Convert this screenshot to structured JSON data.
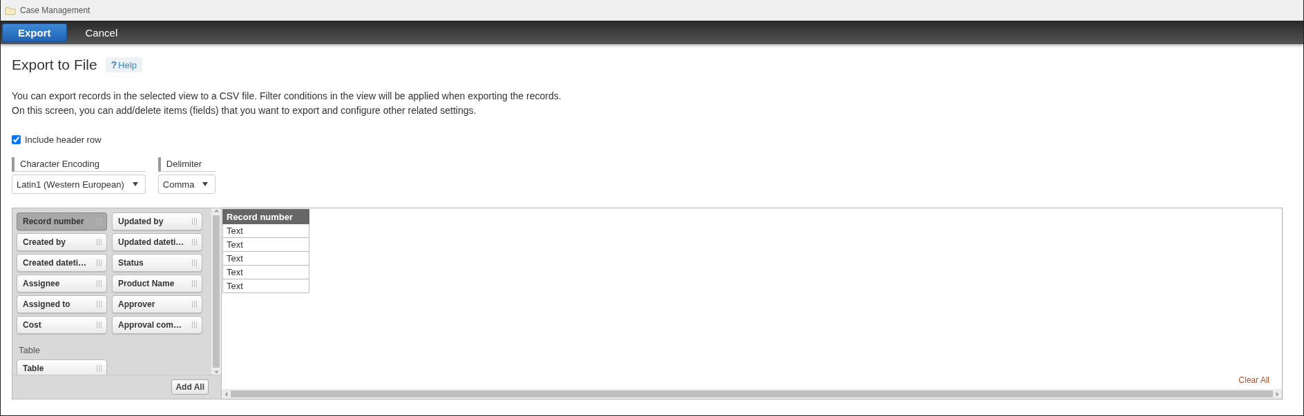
{
  "window": {
    "title": "Case Management"
  },
  "toolbar": {
    "buttons": [
      {
        "label": "Export",
        "primary": true
      },
      {
        "label": "Cancel",
        "primary": false
      }
    ]
  },
  "page": {
    "title": "Export to File",
    "help_icon": "?",
    "help": "Help"
  },
  "description": [
    "You can export records in the selected view to a CSV file. Filter conditions in the view will be applied when exporting the records.",
    "On this screen, you can add/delete items (fields) that you want to export and configure other related settings."
  ],
  "include_header_row": {
    "label": "Include header row",
    "checked": true
  },
  "settings": [
    {
      "label": "Character Encoding",
      "value": "Latin1 (Western European)"
    },
    {
      "label": "Delimiter",
      "value": "Comma"
    }
  ],
  "fields": [
    {
      "label": "Record number",
      "selected": true
    },
    {
      "label": "Updated by",
      "selected": false
    },
    {
      "label": "Created by",
      "selected": false
    },
    {
      "label": "Updated dateti…",
      "selected": false
    },
    {
      "label": "Created dateti…",
      "selected": false
    },
    {
      "label": "Status",
      "selected": false
    },
    {
      "label": "Assignee",
      "selected": false
    },
    {
      "label": "Product Name",
      "selected": false
    },
    {
      "label": "Assigned to",
      "selected": false
    },
    {
      "label": "Approver",
      "selected": false
    },
    {
      "label": "Cost",
      "selected": false
    },
    {
      "label": "Approval com…",
      "selected": false
    }
  ],
  "groups": [
    {
      "title": "Table",
      "fields": [
        {
          "label": "Table",
          "selected": false
        }
      ]
    }
  ],
  "add_all": "Add All",
  "preview": {
    "columns": [
      "Record number"
    ],
    "rows": [
      "Text",
      "Text",
      "Text",
      "Text",
      "Text"
    ]
  },
  "clear_all": "Clear All"
}
